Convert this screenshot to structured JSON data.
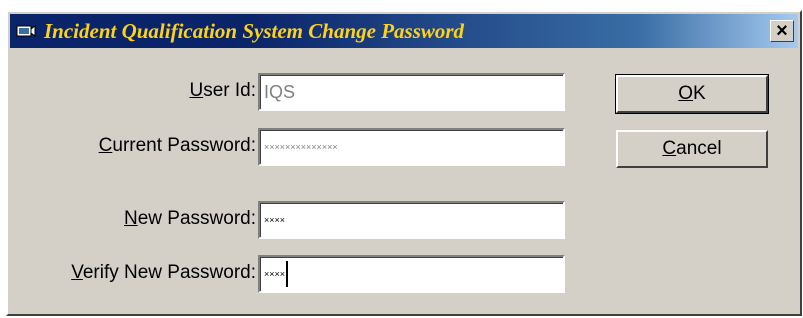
{
  "window": {
    "title": "Incident Qualification System Change Password",
    "close_label": "×"
  },
  "form": {
    "user_id": {
      "label_accel": "U",
      "label_rest": "ser Id:",
      "value": "IQS"
    },
    "current_password": {
      "label_accel": "C",
      "label_rest": "urrent Password:",
      "value": "××××××××××××××"
    },
    "new_password": {
      "label_accel": "N",
      "label_rest": "ew Password:",
      "value": "××××"
    },
    "verify_password": {
      "label_accel": "V",
      "label_rest": "erify New Password:",
      "value": "××××"
    }
  },
  "buttons": {
    "ok": {
      "accel": "O",
      "rest": "K"
    },
    "cancel": {
      "accel": "C",
      "rest": "ancel"
    }
  },
  "colors": {
    "title_bar": "#0a246a",
    "title_text": "#ffd21a",
    "face": "#d4d0c8"
  }
}
